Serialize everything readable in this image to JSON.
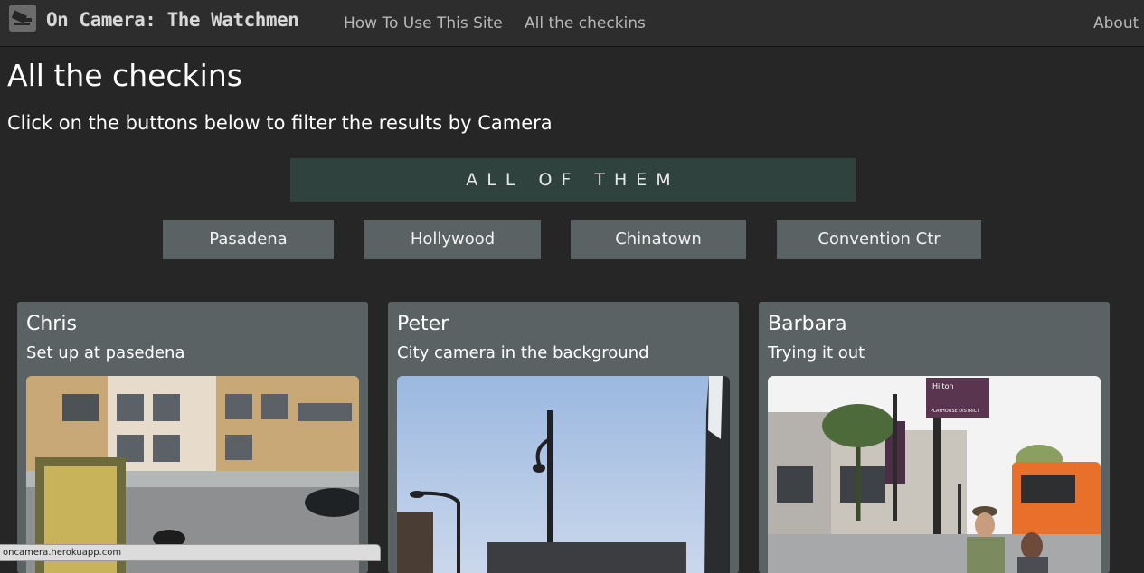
{
  "navbar": {
    "brand": "On Camera: The Watchmen",
    "brand_icon": "camera-icon",
    "links": [
      "How To Use This Site",
      "All the checkins"
    ],
    "right_link": "About"
  },
  "page": {
    "title": "All the checkins",
    "subtitle": "Click on the buttons below to filter the results by Camera"
  },
  "filters": {
    "all_label": "ALL OF THEM",
    "cameras": [
      "Pasadena",
      "Hollywood",
      "Chinatown",
      "Convention Ctr"
    ]
  },
  "checkins": [
    {
      "name": "Chris",
      "text": "Set up at pasedena"
    },
    {
      "name": "Peter",
      "text": "City camera in the background"
    },
    {
      "name": "Barbara",
      "text": "Trying it out"
    }
  ],
  "photo_signs": [
    "Hilton",
    "PLAYHOUSE DISTRICT"
  ],
  "status_bar": "oncamera.herokuapp.com",
  "colors": {
    "background": "#262626",
    "navbar": "#2d2d2d",
    "all_button": "#2f423e",
    "filter_button": "#5a6264",
    "card": "#5b6264"
  }
}
